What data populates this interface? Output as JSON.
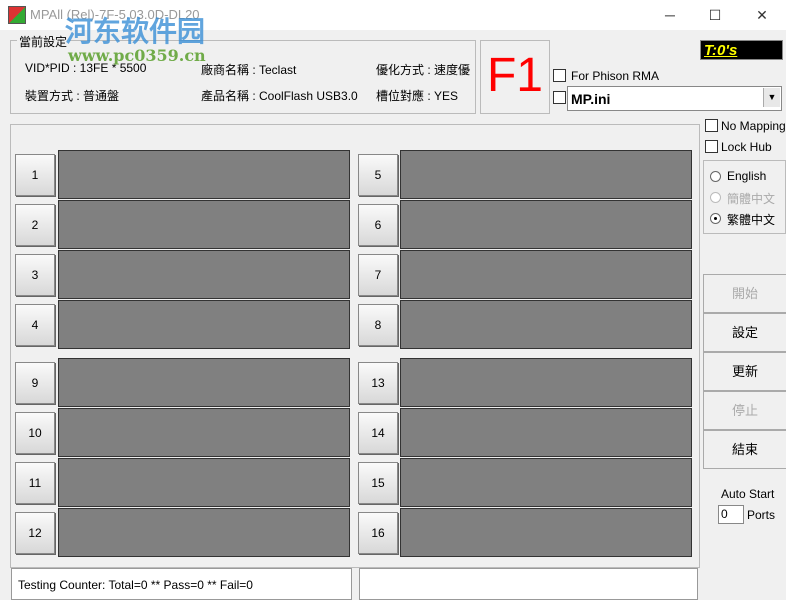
{
  "window": {
    "title": "MPAll (Rel)-7F-5.03.0D-DL20",
    "minimize": "─",
    "maximize": "☐",
    "close": "✕"
  },
  "watermark": {
    "name": "河东软件园",
    "url": "www.pc0359.cn"
  },
  "settings": {
    "label": "當前設定",
    "vidpid": "VID*PID : 13FE * 5500",
    "vendor": "廠商名稱 : Teclast",
    "optimize": "優化方式 : 速度優",
    "device_mode": "裝置方式 : 普通盤",
    "product": "產品名稱 : CoolFlash USB3.0",
    "slot_mapping": "槽位對應 : YES"
  },
  "f1": "F1",
  "timer": "T:0's",
  "for_phison_rma": "For Phison RMA",
  "ini_file": "MP.ini",
  "no_mapping": "No Mapping",
  "lock_hub": "Lock Hub",
  "languages": [
    {
      "label": "English",
      "selected": false,
      "disabled": false
    },
    {
      "label": "簡體中文",
      "selected": false,
      "disabled": true
    },
    {
      "label": "繁體中文",
      "selected": true,
      "disabled": false
    }
  ],
  "ports_left": [
    "1",
    "2",
    "3",
    "4",
    "9",
    "10",
    "11",
    "12"
  ],
  "ports_right": [
    "5",
    "6",
    "7",
    "8",
    "13",
    "14",
    "15",
    "16"
  ],
  "buttons": {
    "start": "開始",
    "setting": "設定",
    "update": "更新",
    "stop": "停止",
    "exit": "結束"
  },
  "auto_start": {
    "label": "Auto Start",
    "value": "0",
    "unit": "Ports"
  },
  "status": "Testing Counter: Total=0 ** Pass=0 ** Fail=0"
}
